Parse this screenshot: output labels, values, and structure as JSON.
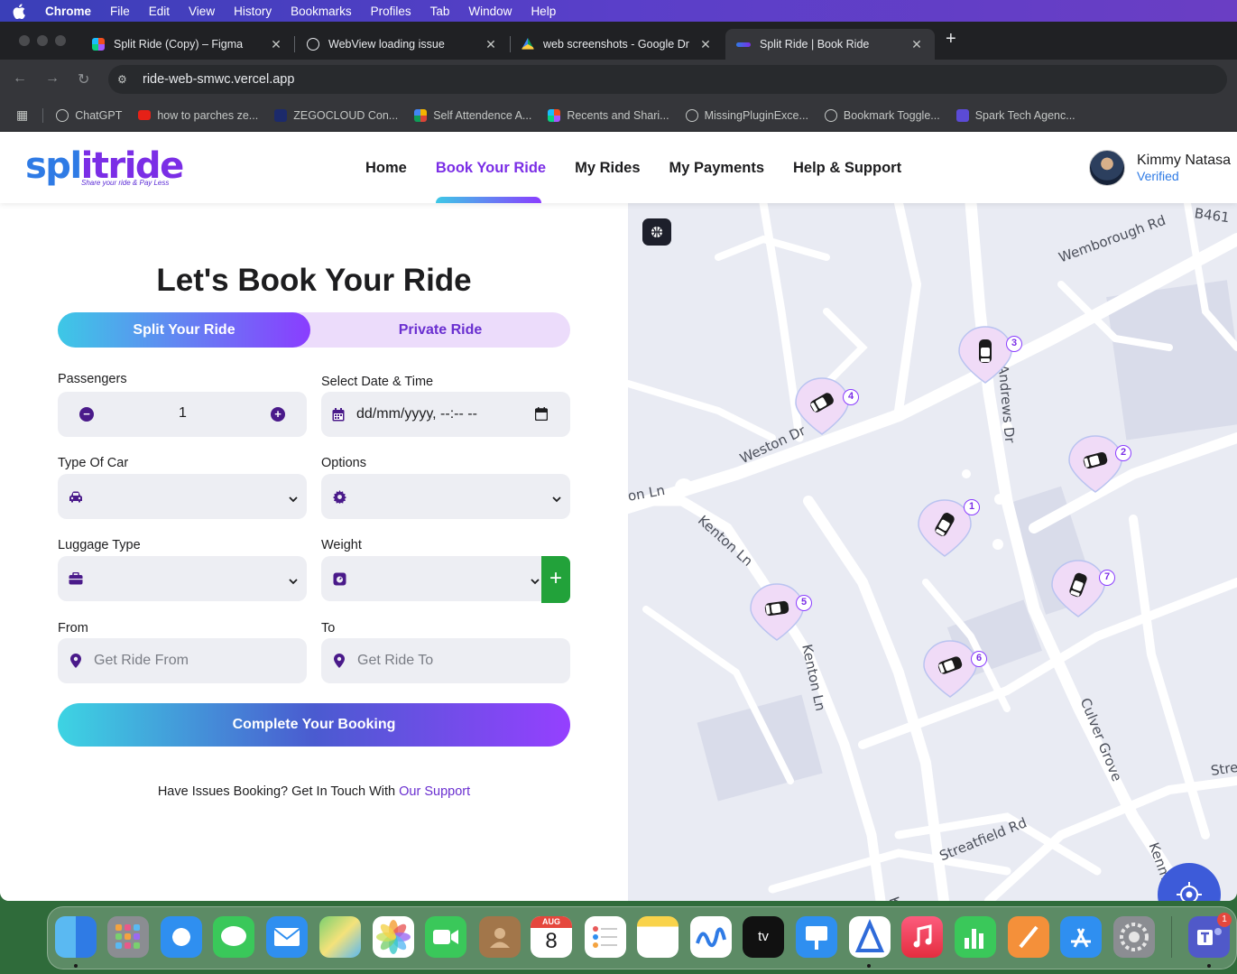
{
  "menubar": {
    "items": [
      "Chrome",
      "File",
      "Edit",
      "View",
      "History",
      "Bookmarks",
      "Profiles",
      "Tab",
      "Window",
      "Help"
    ]
  },
  "browser": {
    "tabs": [
      {
        "title": "Split Ride (Copy) – Figma",
        "icon": "figma-icon"
      },
      {
        "title": "WebView loading issue",
        "icon": "chatgpt-icon"
      },
      {
        "title": "web screenshots - Google Dr",
        "icon": "google-drive-icon"
      },
      {
        "title": "Split Ride | Book Ride",
        "icon": "splitride-favicon"
      }
    ],
    "url": "ride-web-smwc.vercel.app",
    "bookmarks": [
      {
        "label": "ChatGPT"
      },
      {
        "label": "how to parches ze..."
      },
      {
        "label": "ZEGOCLOUD Con..."
      },
      {
        "label": "Self Attendence A..."
      },
      {
        "label": "Recents and Shari..."
      },
      {
        "label": "MissingPluginExce..."
      },
      {
        "label": "Bookmark Toggle..."
      },
      {
        "label": "Spark Tech Agenc..."
      }
    ]
  },
  "header": {
    "logo_main_a": "spl",
    "logo_main_b": "i",
    "logo_main_c": "tride",
    "logo_tagline": "Share your ride & Pay Less",
    "nav": [
      "Home",
      "Book Your Ride",
      "My Rides",
      "My Payments",
      "Help & Support"
    ],
    "active_nav": "Book Your Ride",
    "user_name": "Kimmy Natasa",
    "user_status": "Verified"
  },
  "booking": {
    "title": "Let's Book Your Ride",
    "mode_split": "Split Your Ride",
    "mode_private": "Private Ride",
    "passengers_label": "Passengers",
    "passengers_value": "1",
    "datetime_label": "Select Date & Time",
    "datetime_value": "dd/mm/yyyy, --:-- --",
    "car_type_label": "Type Of Car",
    "options_label": "Options",
    "luggage_label": "Luggage Type",
    "weight_label": "Weight",
    "from_label": "From",
    "from_placeholder": "Get Ride From",
    "to_label": "To",
    "to_placeholder": "Get Ride To",
    "submit": "Complete Your Booking",
    "support_text": "Have Issues Booking? Get In Touch With",
    "support_link": "Our Support"
  },
  "map": {
    "streets": [
      "Wemborough Rd",
      "B461",
      "St Andrews Dr",
      "Weston Dr",
      "Kenton Ln",
      "Kenton Ln",
      "on Ln",
      "Culver Grove",
      "Streatfield Rd",
      "Stre",
      "Kenm",
      "Ke"
    ],
    "markers": [
      "1",
      "2",
      "3",
      "4",
      "5",
      "6",
      "7"
    ]
  },
  "colors": {
    "accent_purple": "#7b2ee6",
    "gradient_start": "#3dc8e6",
    "gradient_end": "#8a3dff",
    "verified_blue": "#2f7be5",
    "add_green": "#22a23a"
  },
  "dock": {
    "calendar_month": "AUG",
    "calendar_day": "8",
    "teams_badge": "1"
  }
}
